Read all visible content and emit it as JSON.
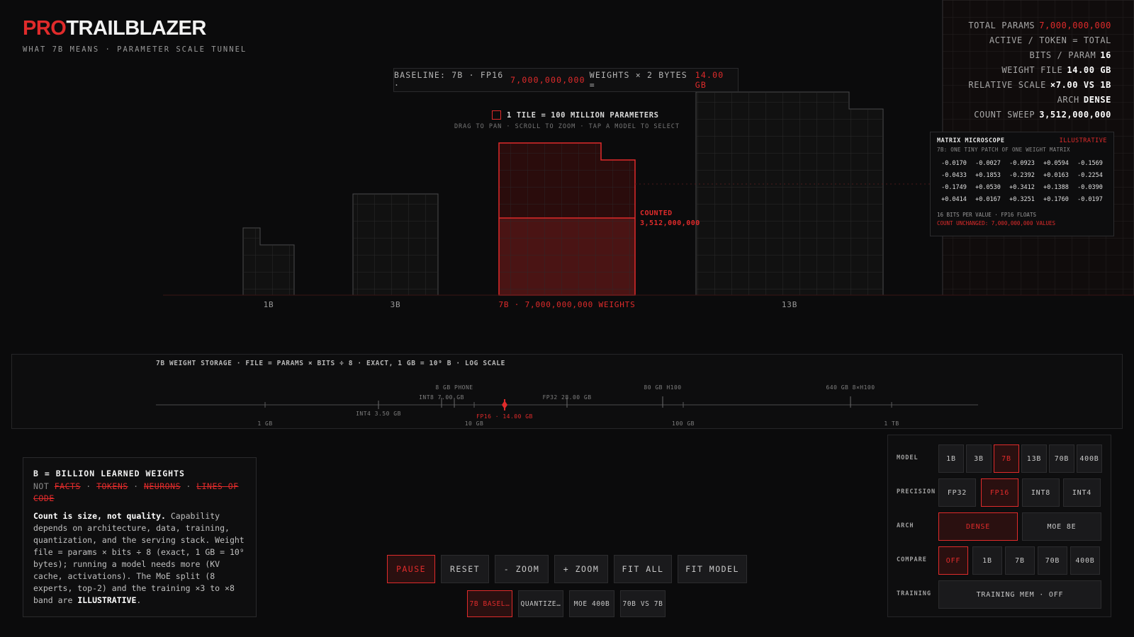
{
  "brand": {
    "prefix": "PRO",
    "name": "TRAILBLAZER",
    "subtitle": "WHAT 7B MEANS · PARAMETER SCALE TUNNEL"
  },
  "stats": [
    {
      "label": "TOTAL PARAMS",
      "value": "7,000,000,000",
      "accent": true
    },
    {
      "label": "ACTIVE / TOKEN = TOTAL",
      "value": "",
      "accent": false
    },
    {
      "label": "BITS / PARAM",
      "value": "16",
      "accent": false
    },
    {
      "label": "WEIGHT FILE",
      "value": "14.00 GB",
      "accent": false
    },
    {
      "label": "RELATIVE SCALE",
      "value": "×7.00 VS 1B",
      "accent": false
    },
    {
      "label": "ARCH",
      "value": "DENSE",
      "accent": false
    },
    {
      "label": "COUNT SWEEP",
      "value": "3,512,000,000",
      "accent": false
    }
  ],
  "baseline": {
    "p1": "BASELINE: 7B · FP16 ·",
    "params": "7,000,000,000",
    "p2": "WEIGHTS × 2 BYTES =",
    "size": "14.00 GB"
  },
  "legend": {
    "tile": "1 TILE = 100 MILLION PARAMETERS",
    "hint": "DRAG TO PAN · SCROLL TO ZOOM · TAP A MODEL TO SELECT"
  },
  "tunnel": {
    "labels": {
      "m1b": "1B",
      "m3b": "3B",
      "m7b": "7B · 7,000,000,000 WEIGHTS",
      "m13b": "13B"
    },
    "counted_label": "COUNTED",
    "counted_value": "3,512,000,000",
    "selected": "7B"
  },
  "microscope": {
    "title": "MATRIX MICROSCOPE",
    "tag": "ILLUSTRATIVE",
    "subtitle": "7B: ONE TINY PATCH OF ONE WEIGHT MATRIX",
    "values": [
      [
        "-0.0170",
        "-0.0027",
        "-0.0923",
        "+0.0594",
        "-0.1569"
      ],
      [
        "-0.0433",
        "+0.1853",
        "-0.2392",
        "+0.0163",
        "-0.2254"
      ],
      [
        "-0.1749",
        "+0.0530",
        "+0.3412",
        "+0.1388",
        "-0.0390"
      ],
      [
        "+0.0414",
        "+0.0167",
        "+0.3251",
        "+0.1760",
        "-0.0197"
      ]
    ],
    "footer1": "16 BITS PER VALUE · FP16 FLOATS",
    "footer2": "COUNT UNCHANGED: 7,000,000,000 VALUES"
  },
  "storage": {
    "title": "7B WEIGHT STORAGE · FILE = PARAMS × BITS ÷ 8 · EXACT, 1 GB = 10⁹ B · LOG SCALE",
    "markers": {
      "phone": "8 GB PHONE",
      "h100": "80 GB H100",
      "h100x8": "640 GB 8×H100",
      "int8": "INT8 7.00 GB",
      "fp32": "FP32 28.00 GB",
      "int4": "INT4 3.50 GB",
      "fp16": "FP16 · 14.00 GB"
    },
    "ticks": [
      "1 GB",
      "10 GB",
      "100 GB",
      "1 TB"
    ]
  },
  "info": {
    "heading": "B = BILLION LEARNED WEIGHTS",
    "not_prefix": "NOT",
    "not_items": [
      "FACTS",
      "TOKENS",
      "NEURONS",
      "LINES OF CODE"
    ],
    "bold_lead": "Count is size, not quality.",
    "body": " Capability depends on architecture, data, training, quantization, and the serving stack. Weight file = params × bits ÷ 8 (exact, 1 GB = 10⁹ bytes); running a model needs more (KV cache, activations). The MoE split (8 experts, top-2) and the training ×3 to ×8 band are ",
    "bold_tail": "ILLUSTRATIVE",
    "end": "."
  },
  "transport": {
    "pause": "PAUSE",
    "reset": "RESET",
    "zoom_out": "- ZOOM",
    "zoom_in": "+ ZOOM",
    "fit_all": "FIT ALL",
    "fit_model": "FIT MODEL"
  },
  "presets": [
    "7B BASEL…",
    "QUANTIZE…",
    "MOE 400B",
    "70B VS 7B"
  ],
  "controls": {
    "model_label": "MODEL",
    "models": [
      "1B",
      "3B",
      "7B",
      "13B",
      "70B",
      "400B"
    ],
    "model_selected": "7B",
    "precision_label": "PRECISION",
    "precisions": [
      "FP32",
      "FP16",
      "INT8",
      "INT4"
    ],
    "precision_selected": "FP16",
    "arch_label": "ARCH",
    "archs": [
      "DENSE",
      "MOE 8E"
    ],
    "arch_selected": "DENSE",
    "compare_label": "COMPARE",
    "compares": [
      "OFF",
      "1B",
      "7B",
      "70B",
      "400B"
    ],
    "compare_selected": "OFF",
    "training_label": "TRAINING",
    "training_value": "TRAINING MEM · OFF"
  },
  "colors": {
    "accent": "#e02b2b",
    "bg": "#0b0b0c",
    "grid": "#2e2e30"
  }
}
